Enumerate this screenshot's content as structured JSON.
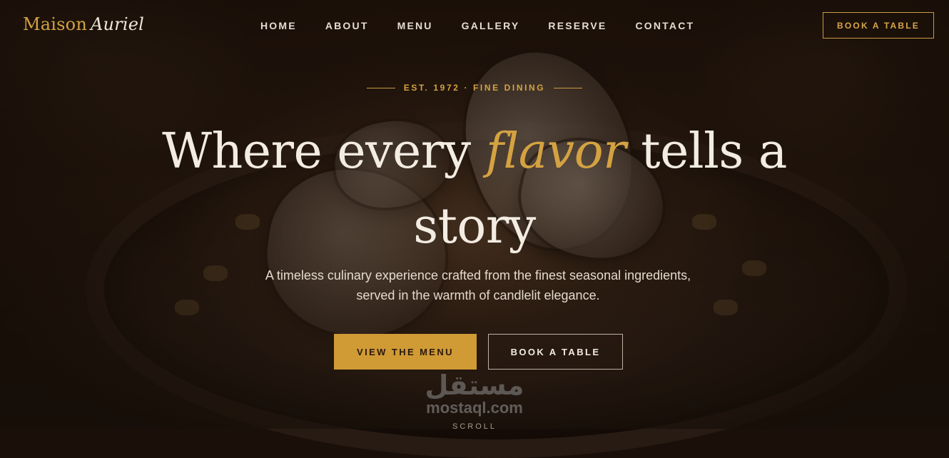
{
  "brand": {
    "name_primary": "Maison",
    "name_accent": "Auriel"
  },
  "nav": {
    "items": [
      {
        "label": "HOME"
      },
      {
        "label": "ABOUT"
      },
      {
        "label": "MENU"
      },
      {
        "label": "GALLERY"
      },
      {
        "label": "RESERVE"
      },
      {
        "label": "CONTACT"
      }
    ],
    "cta_label": "BOOK A TABLE"
  },
  "hero": {
    "eyebrow": "EST. 1972 · FINE DINING",
    "headline_before": "Where every ",
    "headline_accent": "flavor",
    "headline_after": " tells a story",
    "subtitle": "A timeless culinary experience crafted from the finest seasonal ingredients, served in the warmth of candlelit elegance.",
    "primary_button": "VIEW THE MENU",
    "secondary_button": "BOOK A TABLE",
    "scroll_label": "SCROLL"
  },
  "watermark": {
    "logo_text": "مستقل",
    "site": "mostaql.com"
  },
  "colors": {
    "gold": "#d4a241",
    "button_gold": "#d09a35",
    "cream": "#f3ece2",
    "background": "#1a0f09"
  }
}
